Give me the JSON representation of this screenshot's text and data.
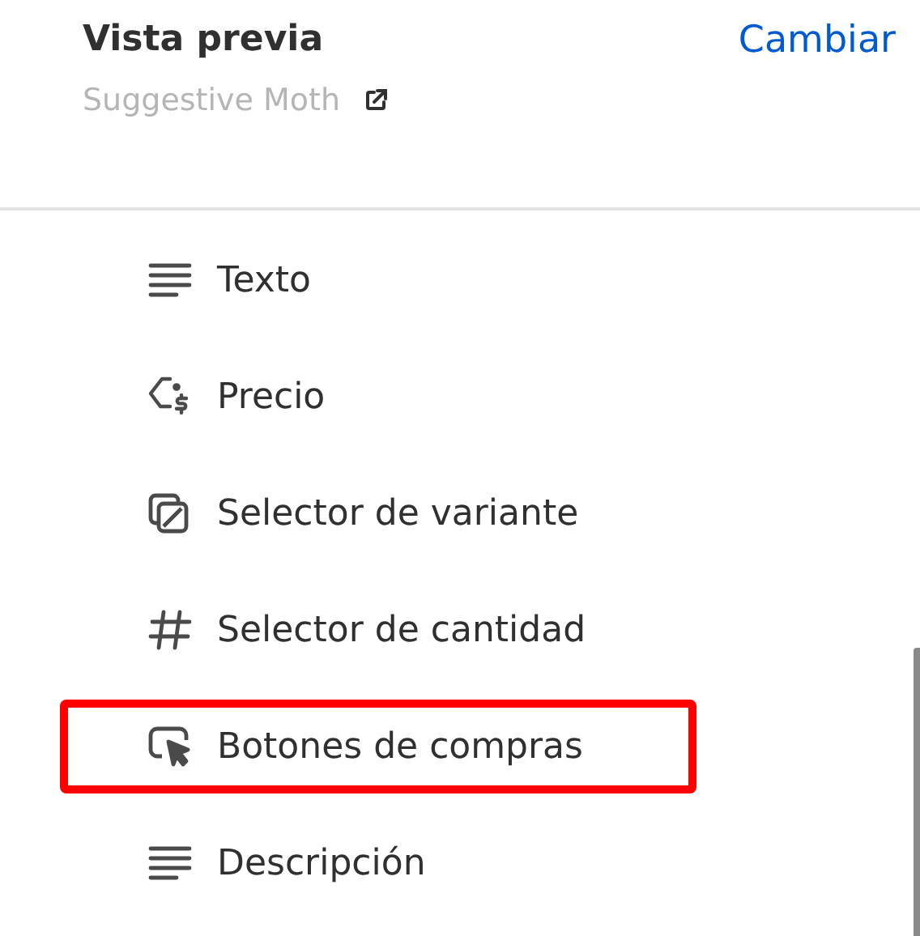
{
  "header": {
    "title": "Vista previa",
    "action": "Cambiar",
    "subtitle": "Suggestive Moth"
  },
  "items": [
    {
      "label": "Texto",
      "kind": "text",
      "highlighted": false
    },
    {
      "label": "Precio",
      "kind": "price",
      "highlighted": false
    },
    {
      "label": "Selector de variante",
      "kind": "variant",
      "highlighted": false
    },
    {
      "label": "Selector de cantidad",
      "kind": "quantity",
      "highlighted": false
    },
    {
      "label": "Botones de compras",
      "kind": "buy",
      "highlighted": true
    },
    {
      "label": "Descripción",
      "kind": "text",
      "highlighted": false
    }
  ]
}
